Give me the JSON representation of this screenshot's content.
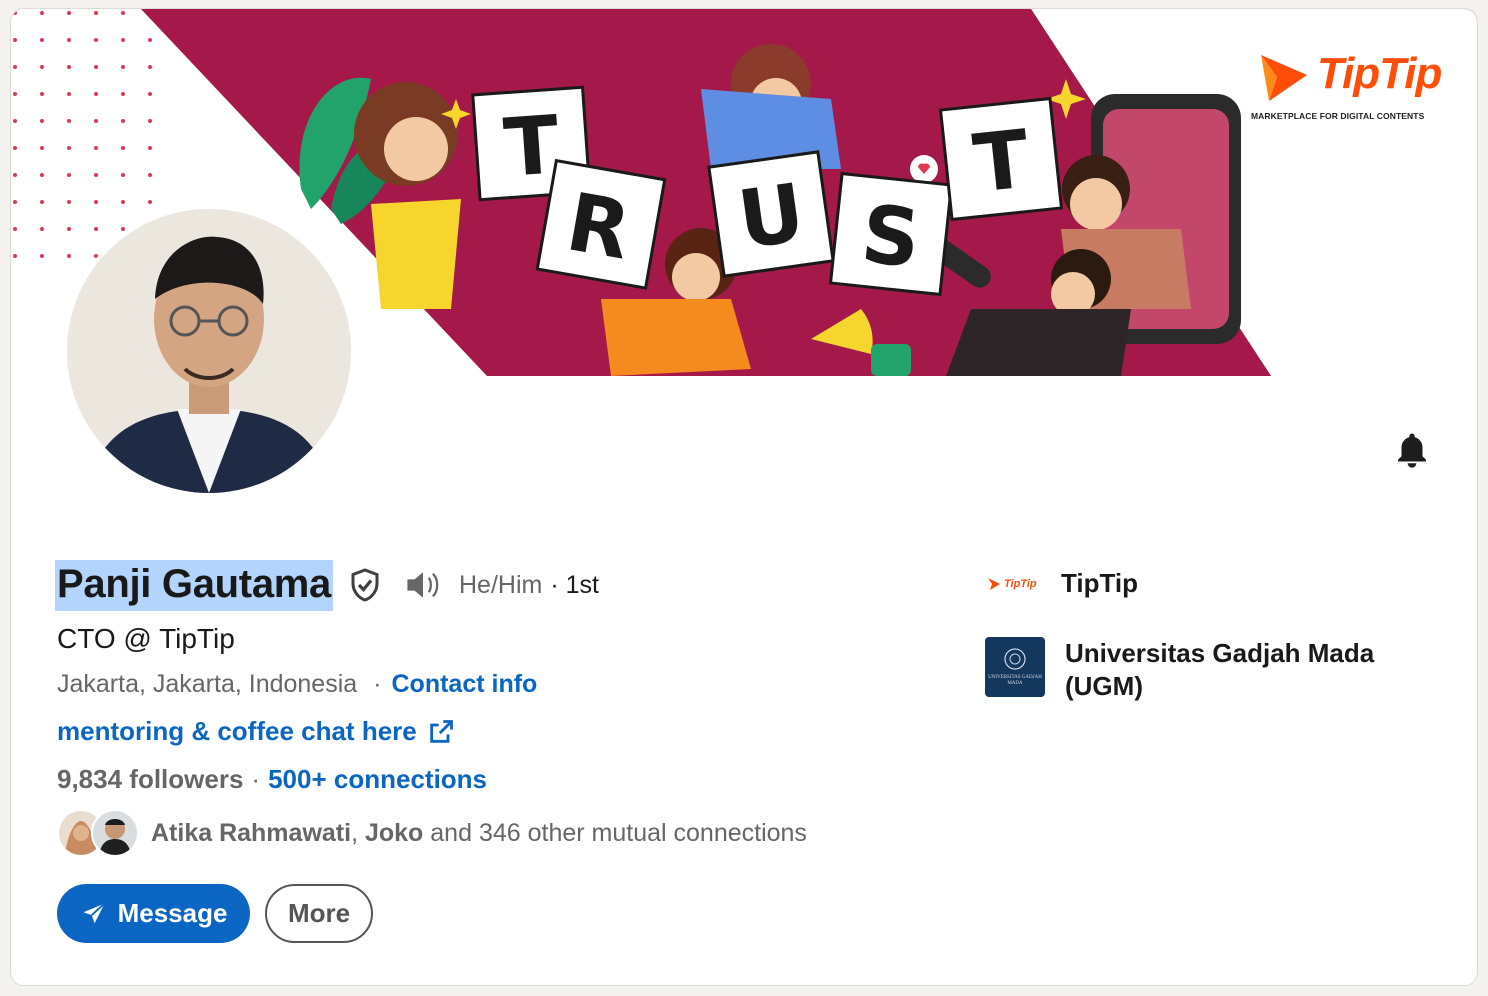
{
  "banner": {
    "word_letters": [
      "T",
      "R",
      "U",
      "S",
      "T"
    ],
    "brand_name": "TipTip",
    "brand_tagline": "MARKETPLACE FOR DIGITAL CONTENTS",
    "colors": {
      "banner": "#a5194a",
      "brand_orange": "#ff4d0a"
    }
  },
  "profile": {
    "name": "Panji Gautama",
    "pronouns": "He/Him",
    "degree": "· 1st",
    "headline": "CTO @ TipTip",
    "location": "Jakarta, Jakarta, Indonesia",
    "contact_sep": "·",
    "contact_label": "Contact info",
    "external_link": "mentoring & coffee chat here",
    "followers": "9,834 followers",
    "followers_sep": "·",
    "connections": "500+ connections",
    "mutual": {
      "name1": "Atika Rahmawati",
      "sep": ",",
      "name2": "Joko",
      "rest": "and 346 other mutual connections"
    }
  },
  "actions": {
    "message_label": "Message",
    "more_label": "More"
  },
  "orgs": [
    {
      "name": "TipTip",
      "logo_text": "TipTip"
    },
    {
      "name": "Universitas Gadjah Mada (UGM)",
      "logo_text": "UNIVERSITAS GADJAH MADA"
    }
  ],
  "icons": {
    "verify": "shield-check-icon",
    "pronounce": "speaker-icon",
    "notify": "bell-icon",
    "external": "external-link-icon",
    "send": "send-icon"
  },
  "colors": {
    "link": "#0a66c2",
    "highlight": "#b3d4fc",
    "text": "#191919",
    "muted": "#666666"
  }
}
